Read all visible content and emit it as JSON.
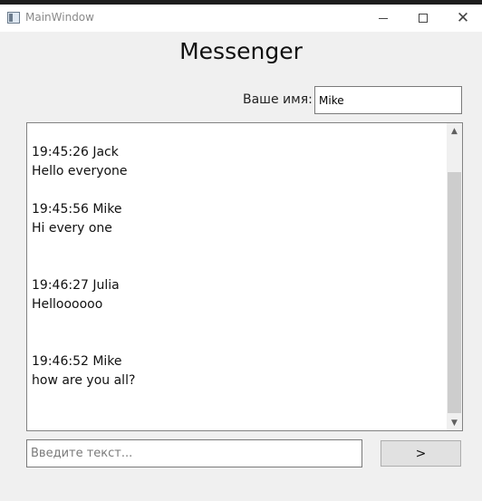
{
  "window": {
    "title": "MainWindow",
    "close_glyph": "✕"
  },
  "header": {
    "title": "Messenger"
  },
  "name_field": {
    "label": "Ваше имя:",
    "value": "Mike"
  },
  "chat": {
    "messages": [
      {
        "header": "19:45:26 Jack",
        "text": "Hello everyone"
      },
      {
        "header": "19:45:56 Mike",
        "text": "Hi every one"
      },
      {
        "header": "19:46:27 Julia",
        "text": "Helloooooo"
      },
      {
        "header": "19:46:52 Mike",
        "text": "how are you all?"
      }
    ],
    "scroll_up_glyph": "▲",
    "scroll_down_glyph": "▼"
  },
  "composer": {
    "placeholder": "Введите текст...",
    "send_label": ">"
  }
}
